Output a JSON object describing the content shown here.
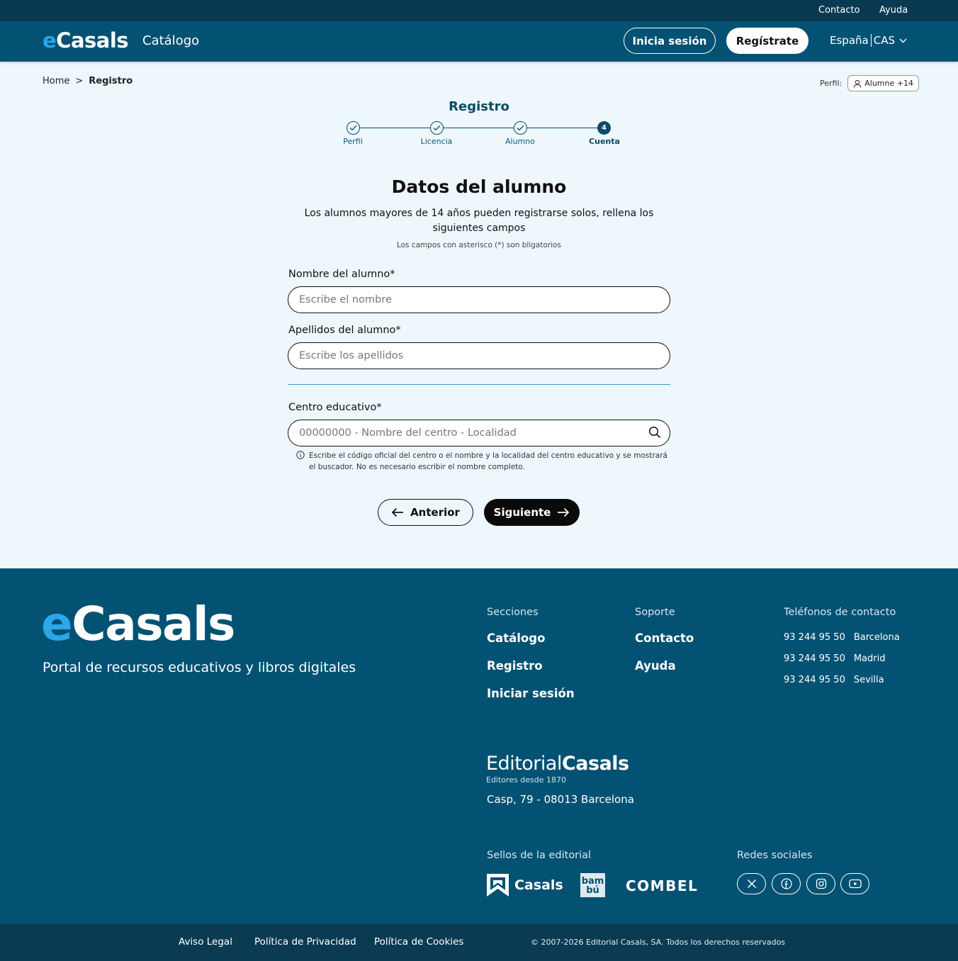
{
  "topbar": {
    "contact": "Contacto",
    "help": "Ayuda"
  },
  "header": {
    "logo_e": "e",
    "logo_rest": "Casals",
    "catalog": "Catálogo",
    "login": "Inicia sesión",
    "register": "Regístrate",
    "country": "España",
    "language": "CAS"
  },
  "breadcrumb": {
    "home": "Home",
    "separator": ">",
    "current": "Registro"
  },
  "profile": {
    "label": "Perfil:",
    "value": "Alumne +14"
  },
  "stepper": {
    "title": "Registro",
    "steps": [
      {
        "label": "Perfil",
        "state": "done"
      },
      {
        "label": "Licencia",
        "state": "done"
      },
      {
        "label": "Alumno",
        "state": "done"
      },
      {
        "label": "Cuenta",
        "state": "active",
        "number": "4"
      }
    ]
  },
  "form": {
    "title": "Datos del alumno",
    "subtitle": "Los alumnos mayores de 14 años pueden registrarse solos, rellena los siguientes campos",
    "note": "Los campos con asterisco (*) son bligatorios",
    "name_label": "Nombre del alumno*",
    "name_placeholder": "Escribe el nombre",
    "surname_label": "Apellidos del alumno*",
    "surname_placeholder": "Escribe los apellidos",
    "school_label": "Centro educativo*",
    "school_placeholder": "00000000 - Nombre del centro - Localidad",
    "school_hint": "Escribe el código oficial del centro o el nombre y la localidad del centro educativo y se mostrará el buscador. No es necesario escribir el nombre completo.",
    "prev": "Anterior",
    "next": "Siguiente"
  },
  "footer": {
    "logo_e": "e",
    "logo_rest": "Casals",
    "tagline": "Portal de recursos educativos y libros digitales",
    "sections_head": "Secciones",
    "sections": [
      "Catálogo",
      "Registro",
      "Iniciar sesión"
    ],
    "support_head": "Soporte",
    "support": [
      "Contacto",
      "Ayuda"
    ],
    "phones_head": "Teléfonos de contacto",
    "phones": [
      {
        "number": "93  244 95 50",
        "city": "Barcelona"
      },
      {
        "number": "93  244 95 50",
        "city": "Madrid"
      },
      {
        "number": "93  244 95 50",
        "city": "Sevilla"
      }
    ],
    "editorial_light": "Editorial",
    "editorial_bold": "Casals",
    "editorial_since": "Editores desde 1870",
    "address": "Casp, 79 - 08013 Barcelona",
    "brands_head": "Sellos de la editorial",
    "brands": [
      "Casals",
      "bam bú",
      "COMBEL"
    ],
    "social_head": "Redes sociales",
    "social_icons": [
      "x-icon",
      "facebook-icon",
      "instagram-icon",
      "youtube-icon"
    ]
  },
  "bottom": {
    "legal": "Aviso Legal",
    "privacy": "Política de Privacidad",
    "cookies": "Política de Cookies",
    "copyright": "© 2007-2026 Editorial Casals, SA. Todos los derechos reservados"
  },
  "colors": {
    "primary": "#035273",
    "dark": "#0a3a52",
    "accent": "#2aa8e8",
    "background": "#eef7fc"
  }
}
